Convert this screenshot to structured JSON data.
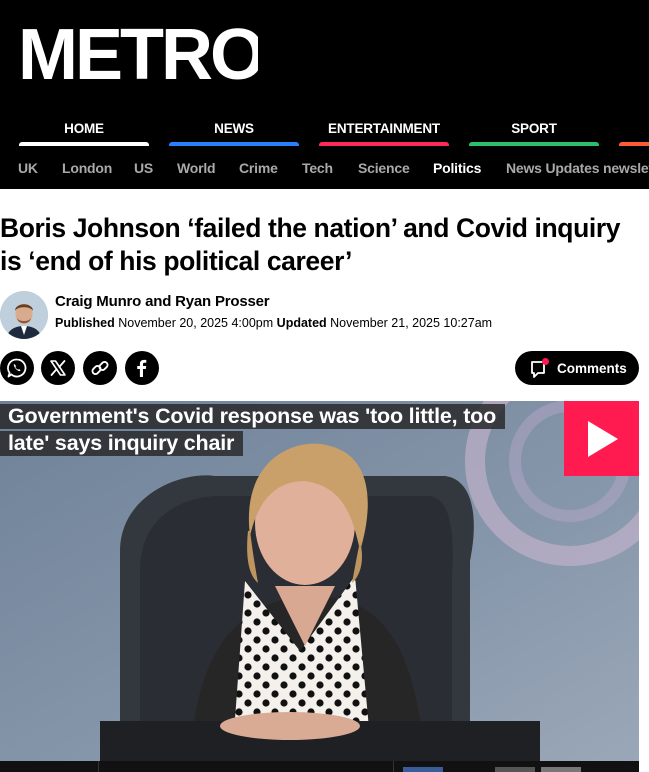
{
  "brand": {
    "logo_text": "METRO",
    "background": "#000000"
  },
  "main_nav": [
    {
      "label": "HOME",
      "color": "#ffffff"
    },
    {
      "label": "NEWS",
      "color": "#2a7fff"
    },
    {
      "label": "ENTERTAINMENT",
      "color": "#ff2a5a"
    },
    {
      "label": "SPORT",
      "color": "#2bbf6a"
    },
    {
      "label": "",
      "color": "#ff5a36"
    }
  ],
  "sub_nav": {
    "items": [
      "UK",
      "London",
      "US",
      "World",
      "Crime",
      "Tech",
      "Science",
      "Politics",
      "News Updates newslet"
    ],
    "active": "Politics"
  },
  "article": {
    "headline": "Boris Johnson ‘failed the nation’ and Covid inquiry is ‘end of his political career’",
    "authors": "Craig Munro and Ryan Prosser",
    "published_label": "Published",
    "published": "November 20, 2025 4:00pm",
    "updated_label": "Updated",
    "updated": "November 21, 2025 10:27am"
  },
  "share": {
    "icons": [
      "whatsapp-icon",
      "x-icon",
      "copy-link-icon",
      "facebook-icon"
    ],
    "comments_label": "Comments",
    "comments_dot_color": "#ff1a4f"
  },
  "video": {
    "caption": "Government's Covid response was 'too little, too late' says inquiry chair",
    "play_color": "#ff1a4f"
  }
}
